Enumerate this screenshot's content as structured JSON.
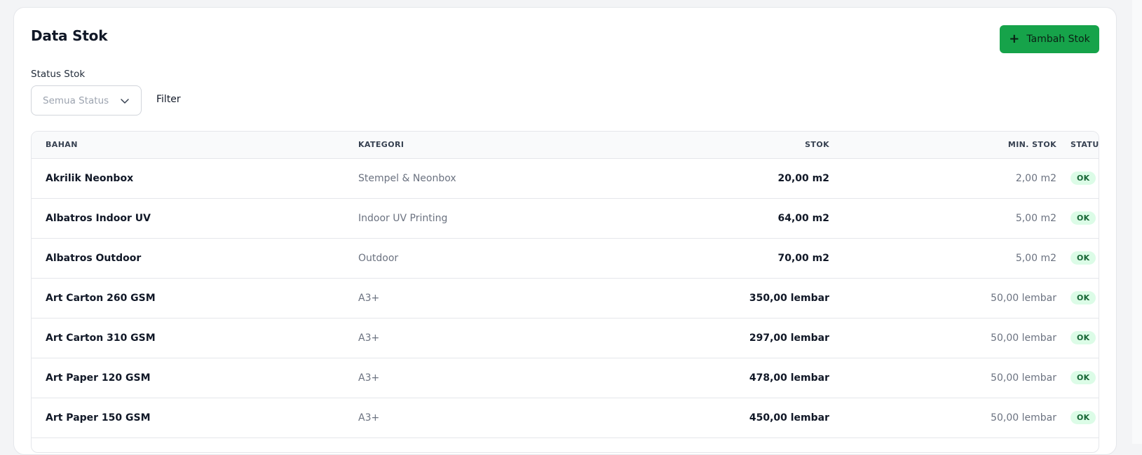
{
  "header": {
    "title": "Data Stok",
    "add_button_label": "Tambah Stok"
  },
  "filters": {
    "status_label": "Status Stok",
    "status_value": "Semua Status",
    "filter_button_label": "Filter"
  },
  "table": {
    "columns": [
      "BAHAN",
      "KATEGORI",
      "STOK",
      "MIN. STOK",
      "STATUS"
    ],
    "rows": [
      {
        "bahan": "Akrilik Neonbox",
        "kategori": "Stempel & Neonbox",
        "stok": "20,00 m2",
        "min_stok": "2,00 m2",
        "status": "OK"
      },
      {
        "bahan": "Albatros Indoor UV",
        "kategori": "Indoor UV Printing",
        "stok": "64,00 m2",
        "min_stok": "5,00 m2",
        "status": "OK"
      },
      {
        "bahan": "Albatros Outdoor",
        "kategori": "Outdoor",
        "stok": "70,00 m2",
        "min_stok": "5,00 m2",
        "status": "OK"
      },
      {
        "bahan": "Art Carton 260 GSM",
        "kategori": "A3+",
        "stok": "350,00 lembar",
        "min_stok": "50,00 lembar",
        "status": "OK"
      },
      {
        "bahan": "Art Carton 310 GSM",
        "kategori": "A3+",
        "stok": "297,00 lembar",
        "min_stok": "50,00 lembar",
        "status": "OK"
      },
      {
        "bahan": "Art Paper 120 GSM",
        "kategori": "A3+",
        "stok": "478,00 lembar",
        "min_stok": "50,00 lembar",
        "status": "OK"
      },
      {
        "bahan": "Art Paper 150 GSM",
        "kategori": "A3+",
        "stok": "450,00 lembar",
        "min_stok": "50,00 lembar",
        "status": "OK"
      }
    ]
  },
  "colors": {
    "primary_button": "#16a34a",
    "ok_badge_bg": "#dcfce7",
    "ok_badge_text": "#166534"
  },
  "icons": {
    "add_button": "plus-icon",
    "select": "chevron-down-icon"
  }
}
